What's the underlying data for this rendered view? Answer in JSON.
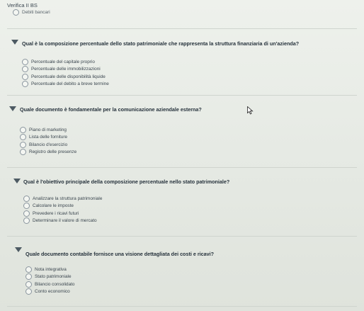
{
  "app": {
    "title": "Verifica II BS"
  },
  "previous_option": "Debiti bancari",
  "questions": [
    {
      "text": "Qual è la composizione percentuale dello stato patrimoniale che rappresenta la struttura finanziaria di un'azienda?",
      "options": [
        "Percentuale del capitale proprio",
        "Percentuale delle immobilizzazioni",
        "Percentuale delle disponibilità liquide",
        "Percentuale del debito a breve termine"
      ]
    },
    {
      "text": "Quale documento è fondamentale per la comunicazione aziendale esterna?",
      "options": [
        "Piano di marketing",
        "Lista delle forniture",
        "Bilancio d'esercizio",
        "Registro delle presenze"
      ]
    },
    {
      "text": "Qual è l'obiettivo principale della composizione percentuale nello stato patrimoniale?",
      "options": [
        "Analizzare la struttura patrimoniale",
        "Calcolare le imposte",
        "Prevedere i ricavi futuri",
        "Determinare il valore di mercato"
      ]
    },
    {
      "text": "Quale documento contabile fornisce una visione dettagliata dei costi e ricavi?",
      "options": [
        "Nota integrativa",
        "Stato patrimoniale",
        "Bilancio consolidato",
        "Conto economico"
      ]
    }
  ]
}
